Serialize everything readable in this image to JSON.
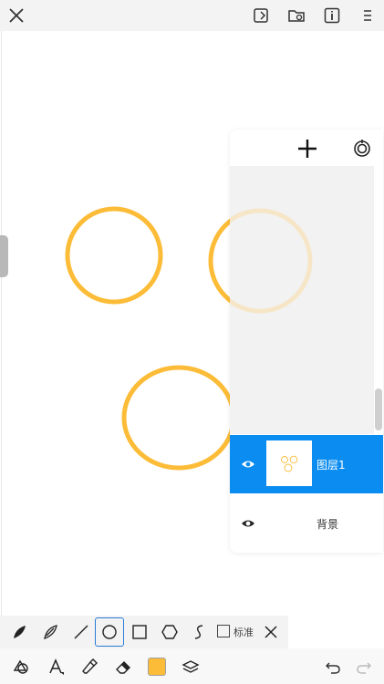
{
  "topbar": {
    "close_icon": "close-icon",
    "icons": [
      "new-page-icon",
      "open-folder-icon",
      "info-icon",
      "menu-icon"
    ]
  },
  "colors": {
    "stroke": "#fcbc37",
    "stroke_faded": "#f6e6c7",
    "active_layer": "#0a8cf0",
    "swatch": "#fcbc37"
  },
  "layers": {
    "items": [
      {
        "name": "图层1",
        "visible": true,
        "active": true
      },
      {
        "name": "背景",
        "visible": true,
        "active": false
      }
    ]
  },
  "toolbar": {
    "tools": [
      "brush-icon",
      "leaf-brush-icon",
      "line-icon",
      "circle-icon",
      "rectangle-icon",
      "hexagon-icon",
      "curve-icon"
    ],
    "selected_tool": "circle-icon",
    "standard_label": "标准",
    "bottom_tools": [
      "shapes-icon",
      "fill-icon",
      "pen-icon",
      "eraser-icon",
      "color-swatch",
      "layers-icon",
      "undo-icon",
      "redo-icon"
    ]
  }
}
